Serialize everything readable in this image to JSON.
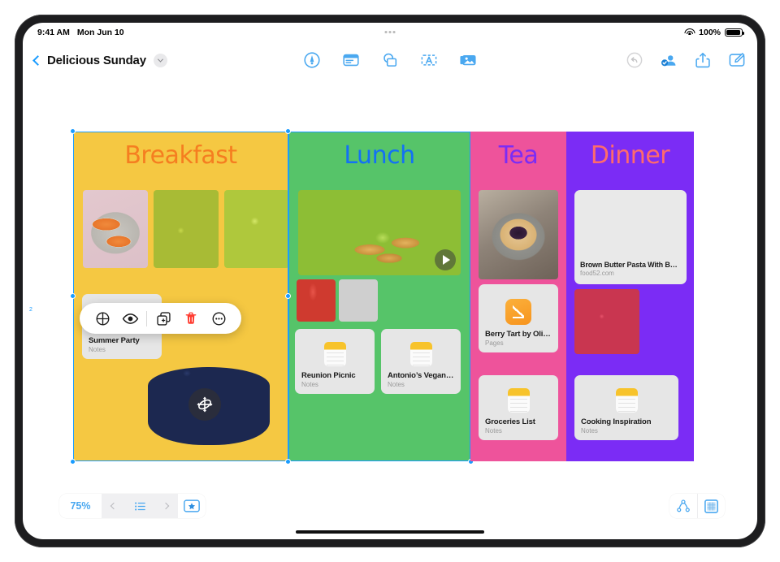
{
  "status_bar": {
    "time": "9:41 AM",
    "date": "Mon Jun 10",
    "wifi_icon": "wifi-icon",
    "battery_percent": "100%",
    "battery_icon": "battery-icon"
  },
  "nav_bar": {
    "back_icon": "chevron-left-icon",
    "document_title": "Delicious Sunday",
    "title_chevron_icon": "chevron-down-icon",
    "center_tools": [
      {
        "name": "draw-tool",
        "icon": "pen-circle-icon"
      },
      {
        "name": "note-tool",
        "icon": "note-card-icon"
      },
      {
        "name": "shape-tool",
        "icon": "shapes-icon"
      },
      {
        "name": "text-tool",
        "icon": "text-box-icon"
      },
      {
        "name": "media-tool",
        "icon": "photos-icon"
      }
    ],
    "right_tools": [
      {
        "name": "undo-button",
        "icon": "undo-arrow-icon",
        "enabled": false
      },
      {
        "name": "collaborate-button",
        "icon": "collaborate-person-icon",
        "enabled": true
      },
      {
        "name": "share-button",
        "icon": "share-up-arrow-icon",
        "enabled": true
      },
      {
        "name": "compose-button",
        "icon": "compose-pencil-icon",
        "enabled": true
      }
    ]
  },
  "board": {
    "columns": [
      {
        "id": "breakfast",
        "title": "Breakfast",
        "bg_color": "#F5C842",
        "title_color": "#F57E20",
        "selected": true,
        "photos": [
          {
            "name": "photo-melon-slices",
            "class": "img-melon"
          },
          {
            "name": "photo-figs-plate",
            "class": "img-figs"
          },
          {
            "name": "photo-grapes-beach",
            "class": "img-grapes"
          }
        ],
        "note": {
          "title": "Summer Party",
          "subtitle": "Notes"
        },
        "cutout": {
          "name": "pancake-stack-cutout",
          "handle_icon": "move-3d-handle-icon"
        }
      },
      {
        "id": "lunch",
        "title": "Lunch",
        "bg_color": "#56C469",
        "title_color": "#1371F5",
        "selected": true,
        "video": {
          "name": "video-tacos-plate",
          "play_icon": "play-icon"
        },
        "stacked_photos": [
          {
            "name": "photo-stack-drinks",
            "class": "img-stack1"
          },
          {
            "name": "photo-stack-lemons",
            "class": "img-stack2"
          }
        ],
        "notes": [
          {
            "title": "Reunion Picnic",
            "subtitle": "Notes"
          },
          {
            "title": "Antonio’s Vegan Tacos",
            "subtitle": "Notes"
          }
        ]
      },
      {
        "id": "tea",
        "title": "Tea",
        "bg_color": "#EE539B",
        "title_color": "#7B2CF5",
        "selected": false,
        "photos": [
          {
            "name": "photo-berry-galette",
            "class": "img-tart"
          }
        ],
        "pages_card": {
          "title": "Berry Tart by Olivia",
          "subtitle": "Pages"
        },
        "notes": [
          {
            "title": "Groceries List",
            "subtitle": "Notes"
          }
        ]
      },
      {
        "id": "dinner",
        "title": "Dinner",
        "bg_color": "#7B2CF5",
        "title_color": "#FF6B6B",
        "selected": false,
        "link_card": {
          "title": "Brown Butter Pasta With But…",
          "source": "food52.com",
          "thumb_class": "img-pasta"
        },
        "photos": [
          {
            "name": "photo-garden-salad",
            "class": "img-salad"
          }
        ],
        "notes": [
          {
            "title": "Cooking Inspiration",
            "subtitle": "Notes"
          }
        ]
      }
    ]
  },
  "context_menu": {
    "items": [
      {
        "name": "style-button",
        "icon": "globe-circle-icon",
        "color": "#1a1a1a"
      },
      {
        "name": "preview-button",
        "icon": "eye-icon",
        "color": "#1a1a1a"
      },
      {
        "name": "duplicate-button",
        "icon": "duplicate-icon",
        "color": "#1a1a1a"
      },
      {
        "name": "delete-button",
        "icon": "trash-icon",
        "color": "#FF3B30"
      },
      {
        "name": "more-button",
        "icon": "ellipsis-circle-icon",
        "color": "#1a1a1a"
      }
    ]
  },
  "bottom_bar": {
    "zoom_level": "75%",
    "prev_icon": "chevron-left-icon",
    "page_list_icon": "list-bullet-icon",
    "next_icon": "chevron-right-icon",
    "star_icon": "star-in-rectangle-icon",
    "right_tools": [
      {
        "name": "organize-button",
        "icon": "hierarchy-graph-icon"
      },
      {
        "name": "grid-view-button",
        "icon": "grid-square-icon"
      }
    ]
  },
  "colors": {
    "accent_blue": "#1a9cff",
    "tool_blue": "#4aa8f0",
    "delete_red": "#FF3B30"
  }
}
